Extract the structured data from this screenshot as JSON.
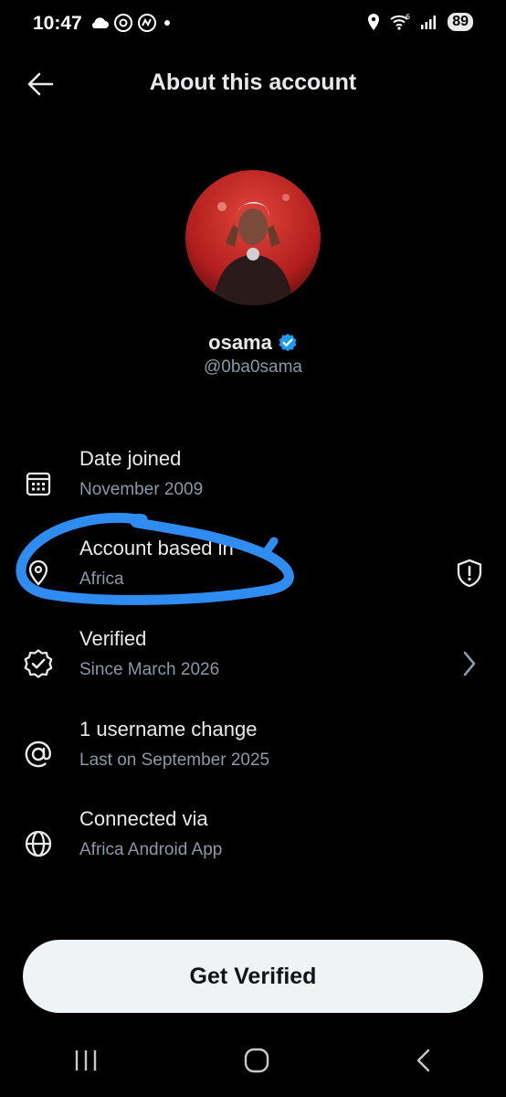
{
  "status": {
    "time": "10:47",
    "battery": "89",
    "signal_label": "6"
  },
  "header": {
    "title": "About this account"
  },
  "profile": {
    "name": "osama",
    "handle": "@0ba0sama"
  },
  "rows": [
    {
      "label": "Date joined",
      "sub": "November 2009",
      "icon": "calendar-icon"
    },
    {
      "label": "Account based in",
      "sub": "Africa",
      "icon": "location-icon",
      "trail_icon": "shield-alert-icon"
    },
    {
      "label": "Verified",
      "sub": "Since March 2026",
      "icon": "verified-badge-icon",
      "trail_icon": "chevron-right-icon"
    },
    {
      "label": "1 username change",
      "sub": "Last on September 2025",
      "icon": "at-icon"
    },
    {
      "label": "Connected via",
      "sub": "Africa Android App",
      "icon": "globe-icon"
    }
  ],
  "cta": {
    "label": "Get Verified"
  },
  "colors": {
    "background": "#000000",
    "verified": "#1d9bf0",
    "scribble": "#2f8cf0",
    "button_bg": "#eff3f4"
  }
}
